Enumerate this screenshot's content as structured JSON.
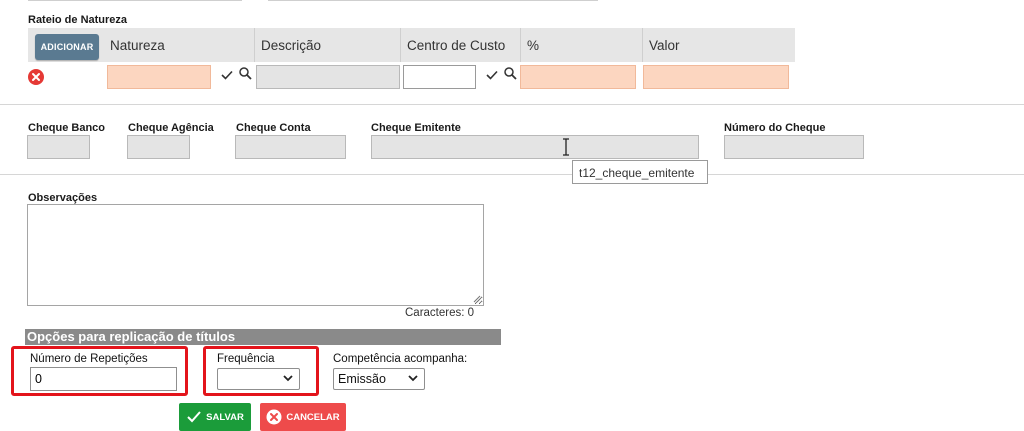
{
  "rateio": {
    "title": "Rateio de Natureza",
    "add_button": "ADICIONAR",
    "columns": [
      "Natureza",
      "Descrição",
      "Centro de Custo",
      "%",
      "Valor"
    ]
  },
  "cheque": {
    "labels": [
      "Cheque Banco",
      "Cheque Agência",
      "Cheque Conta",
      "Cheque Emitente",
      "Número do Cheque"
    ],
    "tooltip": "t12_cheque_emitente"
  },
  "observacoes": {
    "label": "Observações",
    "counter": "Caracteres: 0"
  },
  "replicacao": {
    "title": "Opções para replicação de títulos",
    "repeticoes_label": "Número de Repetições",
    "repeticoes_value": "0",
    "frequencia_label": "Frequência",
    "frequencia_value": "",
    "competencia_label": "Competência acompanha:",
    "competencia_value": "Emissão"
  },
  "actions": {
    "save": "SALVAR",
    "cancel": "CANCELAR"
  },
  "colors": {
    "add_button": "#5a7a91",
    "required_field": "#fcd6c0",
    "readonly_field": "#e4e4e4",
    "highlight_border": "#e3141b",
    "save": "#1b9c3a",
    "cancel": "#ee4b4b",
    "section_bar": "#8a8a8a"
  },
  "icons": [
    "close-circle-icon",
    "check-icon",
    "search-icon",
    "text-cursor-icon",
    "chevron-down-icon",
    "resize-handle-icon",
    "cancel-circle-icon"
  ]
}
